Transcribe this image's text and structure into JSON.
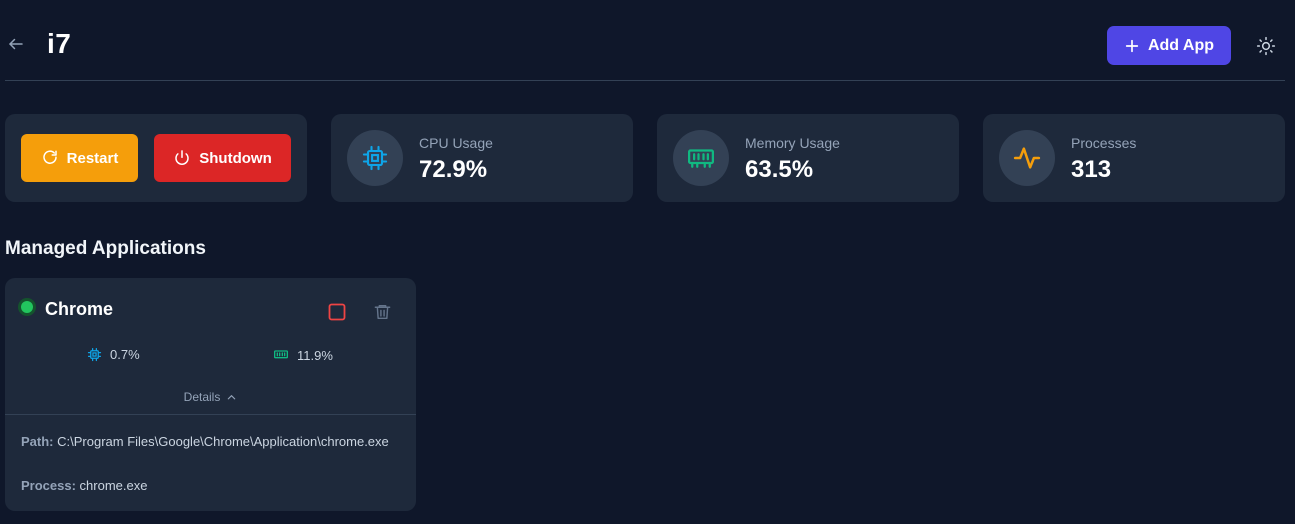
{
  "header": {
    "title": "i7",
    "add_app_label": "Add App"
  },
  "actions": {
    "restart_label": "Restart",
    "shutdown_label": "Shutdown"
  },
  "stats": {
    "cpu": {
      "label": "CPU Usage",
      "value": "72.9%"
    },
    "memory": {
      "label": "Memory Usage",
      "value": "63.5%"
    },
    "processes": {
      "label": "Processes",
      "value": "313"
    }
  },
  "managed": {
    "section_title": "Managed Applications",
    "apps": [
      {
        "name": "Chrome",
        "status": "running",
        "cpu": "0.7%",
        "memory": "11.9%",
        "details_label": "Details",
        "path_key": "Path:",
        "path_value": "C:\\Program Files\\Google\\Chrome\\Application\\chrome.exe",
        "process_key": "Process:",
        "process_value": "chrome.exe"
      }
    ]
  },
  "icons": {
    "back": "arrow-left-icon",
    "add": "plus-icon",
    "theme": "sun-icon",
    "restart": "refresh-icon",
    "shutdown": "power-icon",
    "cpu": "cpu-icon",
    "memory": "memory-icon",
    "processes": "activity-icon",
    "stop": "stop-square-icon",
    "delete": "trash-icon",
    "expand": "chevron-up-icon"
  },
  "colors": {
    "background": "#0f172a",
    "card": "#1e293b",
    "accent": "#4f46e5",
    "restart": "#f59e0b",
    "shutdown": "#dc2626",
    "cpu_icon": "#0ea5e9",
    "memory_icon": "#10b981",
    "processes_icon": "#f59e0b",
    "status_running": "#22c55e"
  }
}
